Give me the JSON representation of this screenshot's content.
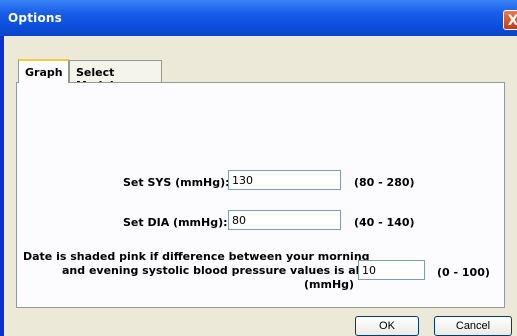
{
  "window": {
    "title": "Options",
    "close_glyph": "X"
  },
  "tabs": [
    {
      "label": "Graph",
      "active": true
    },
    {
      "label": "Select Model",
      "active": false
    }
  ],
  "graph": {
    "sys": {
      "label": "Set SYS (mmHg):",
      "value": "130",
      "range": "(80 - 280)"
    },
    "dia": {
      "label": "Set DIA (mmHg):",
      "value": "80",
      "range": "(40 - 140)"
    },
    "pink": {
      "line1": "Date is shaded pink if difference between your morning",
      "line2": "and evening systolic blood pressure values is above:",
      "line3": "(mmHg)",
      "value": "10",
      "range": "(0 - 100)"
    }
  },
  "buttons": {
    "ok": "OK",
    "cancel": "Cancel"
  },
  "colors": {
    "titlebar": "#0b4fdf",
    "face": "#ece9d8",
    "tab_highlight": "#ffc73c"
  }
}
